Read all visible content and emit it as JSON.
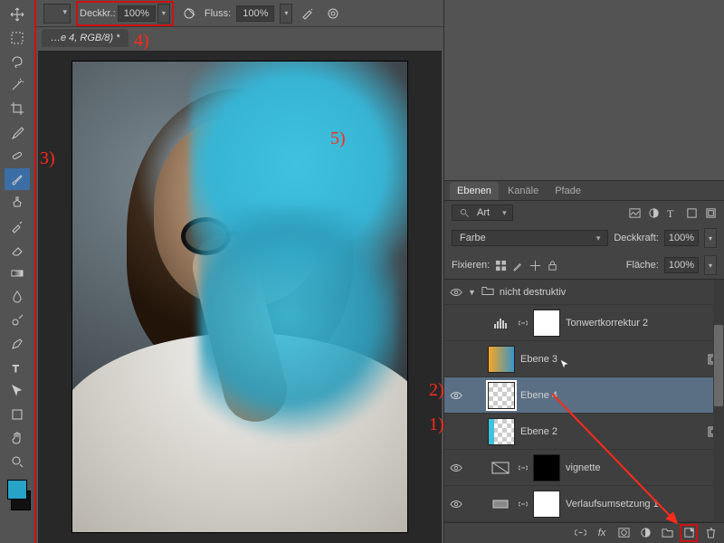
{
  "options_bar": {
    "opacity_label": "Deckkr.:",
    "opacity_value": "100%",
    "flow_label": "Fluss:",
    "flow_value": "100%"
  },
  "document_tab": {
    "title": "…e 4, RGB/8) *"
  },
  "toolbar": {
    "tools": [
      "move",
      "marquee",
      "lasso",
      "wand",
      "crop",
      "eyedropper",
      "heal",
      "brush",
      "clone",
      "history",
      "eraser",
      "gradient",
      "blur",
      "dodge",
      "pen",
      "type",
      "path",
      "shape",
      "hand",
      "zoom"
    ],
    "active": "brush",
    "fg_color": "#27a3c8",
    "bg_color": "#111111"
  },
  "layers_panel": {
    "tabs": {
      "layers": "Ebenen",
      "channels": "Kanäle",
      "paths": "Pfade",
      "active": "layers"
    },
    "filter_label": "Art",
    "blend_mode": "Farbe",
    "opacity_label": "Deckkraft:",
    "opacity_value": "100%",
    "lock_label": "Fixieren:",
    "fill_label": "Fläche:",
    "fill_value": "100%",
    "group": {
      "name": "nicht destruktiv",
      "expanded": true,
      "visible": true
    },
    "layers": [
      {
        "id": "tonwert",
        "name": "Tonwertkorrektur 2",
        "visible": false,
        "kind": "adjustment-levels",
        "mask": true
      },
      {
        "id": "ebene3",
        "name": "Ebene 3",
        "visible": false,
        "kind": "pixel",
        "thumb": "grad",
        "smart": true
      },
      {
        "id": "ebene4",
        "name": "Ebene 4",
        "visible": true,
        "kind": "pixel",
        "thumb": "checker",
        "selected": true
      },
      {
        "id": "ebene2",
        "name": "Ebene 2",
        "visible": false,
        "kind": "pixel",
        "thumb": "checker-cyan",
        "smart": true
      },
      {
        "id": "vignette",
        "name": "vignette",
        "visible": true,
        "kind": "adjustment",
        "mask": true,
        "mask_fill": "black"
      },
      {
        "id": "verlauf",
        "name": "Verlaufsumsetzung 1",
        "visible": true,
        "kind": "adjustment-gradmap",
        "mask": true
      }
    ],
    "footer_icons": [
      "link",
      "fx",
      "mask",
      "adjustment",
      "group",
      "new-layer",
      "trash"
    ]
  },
  "annotations": {
    "a1": "1)",
    "a2": "2)",
    "a3": "3)",
    "a4": "4)",
    "a5": "5)"
  }
}
